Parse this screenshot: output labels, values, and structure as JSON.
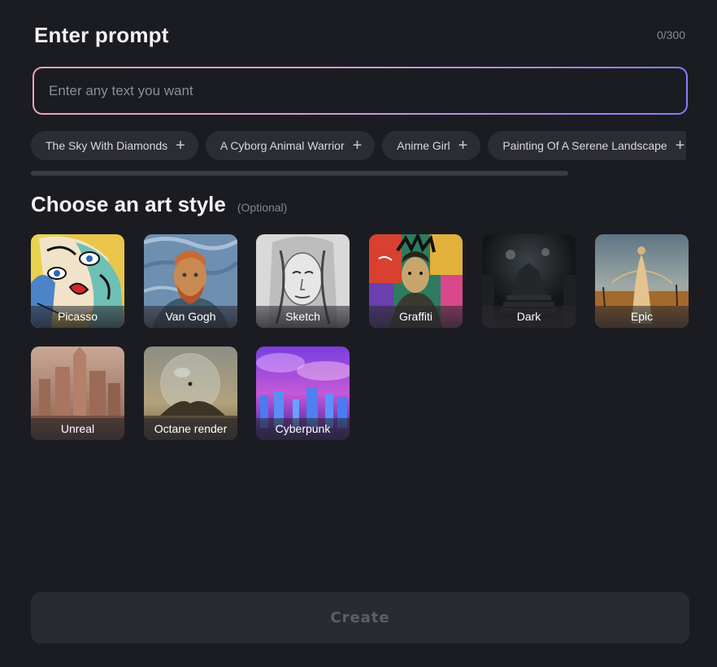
{
  "prompt": {
    "title": "Enter prompt",
    "counter": "0/300",
    "placeholder": "Enter any text you want",
    "value": ""
  },
  "suggestions": [
    {
      "label": "The Sky With Diamonds",
      "icon": "plus-icon"
    },
    {
      "label": "A Cyborg Animal Warrior",
      "icon": "plus-icon"
    },
    {
      "label": "Anime Girl",
      "icon": "plus-icon"
    },
    {
      "label": "Painting Of A Serene Landscape",
      "icon": "plus-icon"
    }
  ],
  "art_style": {
    "title": "Choose an art style",
    "optional_label": "(Optional)",
    "styles": [
      {
        "label": "Picasso"
      },
      {
        "label": "Van Gogh"
      },
      {
        "label": "Sketch"
      },
      {
        "label": "Graffiti"
      },
      {
        "label": "Dark"
      },
      {
        "label": "Epic"
      },
      {
        "label": "Unreal"
      },
      {
        "label": "Octane render"
      },
      {
        "label": "Cyberpunk"
      }
    ]
  },
  "create_button": {
    "label": "Create"
  },
  "colors": {
    "background": "#1b1c21",
    "chip": "#2c2d33",
    "gradient_start": "#f3a3b9",
    "gradient_end": "#8a7cf5"
  }
}
